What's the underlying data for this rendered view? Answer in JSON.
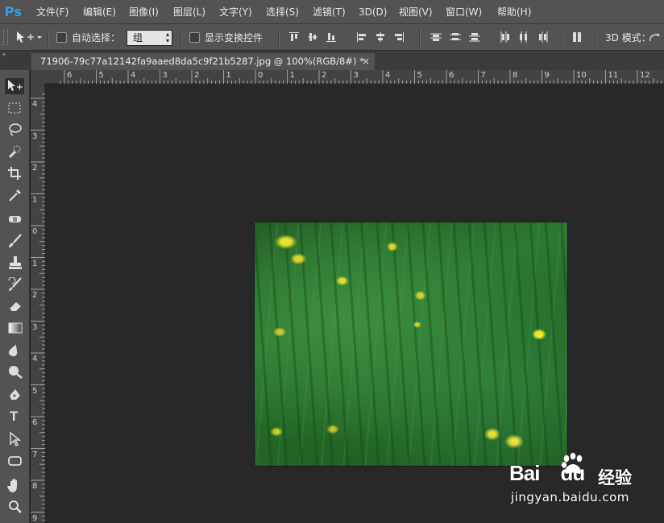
{
  "app": {
    "logo": "Ps"
  },
  "menu": [
    "文件(F)",
    "编辑(E)",
    "图像(I)",
    "图层(L)",
    "文字(Y)",
    "选择(S)",
    "滤镜(T)",
    "3D(D)",
    "视图(V)",
    "窗口(W)",
    "帮助(H)"
  ],
  "options": {
    "auto_select_label": "自动选择：",
    "auto_select_checked": false,
    "auto_select_value": "组",
    "show_transform_label": "显示变换控件",
    "show_transform_checked": false,
    "mode_3d_label": "3D 模式："
  },
  "document_tab": {
    "title": "71906-79c77a12142fa9aaed8da5c9f21b5287.jpg @ 100%(RGB/8#) *",
    "close": "×"
  },
  "panel_collapse": "»",
  "tools": [
    "move-tool",
    "marquee-tool",
    "lasso-tool",
    "quick-selection-tool",
    "crop-tool",
    "eyedropper-tool",
    "healing-brush-tool",
    "brush-tool",
    "clone-stamp-tool",
    "history-brush-tool",
    "eraser-tool",
    "gradient-tool",
    "blur-tool",
    "dodge-tool",
    "pen-tool",
    "type-tool",
    "path-selection-tool",
    "shape-tool",
    "hand-tool",
    "zoom-tool"
  ],
  "type_tool_glyph": "T",
  "ruler_top": [
    "6",
    "5",
    "4",
    "3",
    "2",
    "1",
    "0",
    "1",
    "2",
    "3",
    "4",
    "5",
    "6",
    "7",
    "8",
    "9",
    "10",
    "11",
    "12"
  ],
  "ruler_left": [
    "4",
    "3",
    "2",
    "1",
    "0",
    "1",
    "2",
    "3",
    "4",
    "5",
    "6",
    "7",
    "8",
    "9"
  ],
  "watermark": {
    "brand": "Bai",
    "brand_du": "du",
    "product": "经验",
    "url": "jingyan.baidu.com"
  },
  "colors": {
    "ui_panel": "#535353",
    "canvas_bg": "#282828",
    "ps_blue": "#31a8ff"
  }
}
